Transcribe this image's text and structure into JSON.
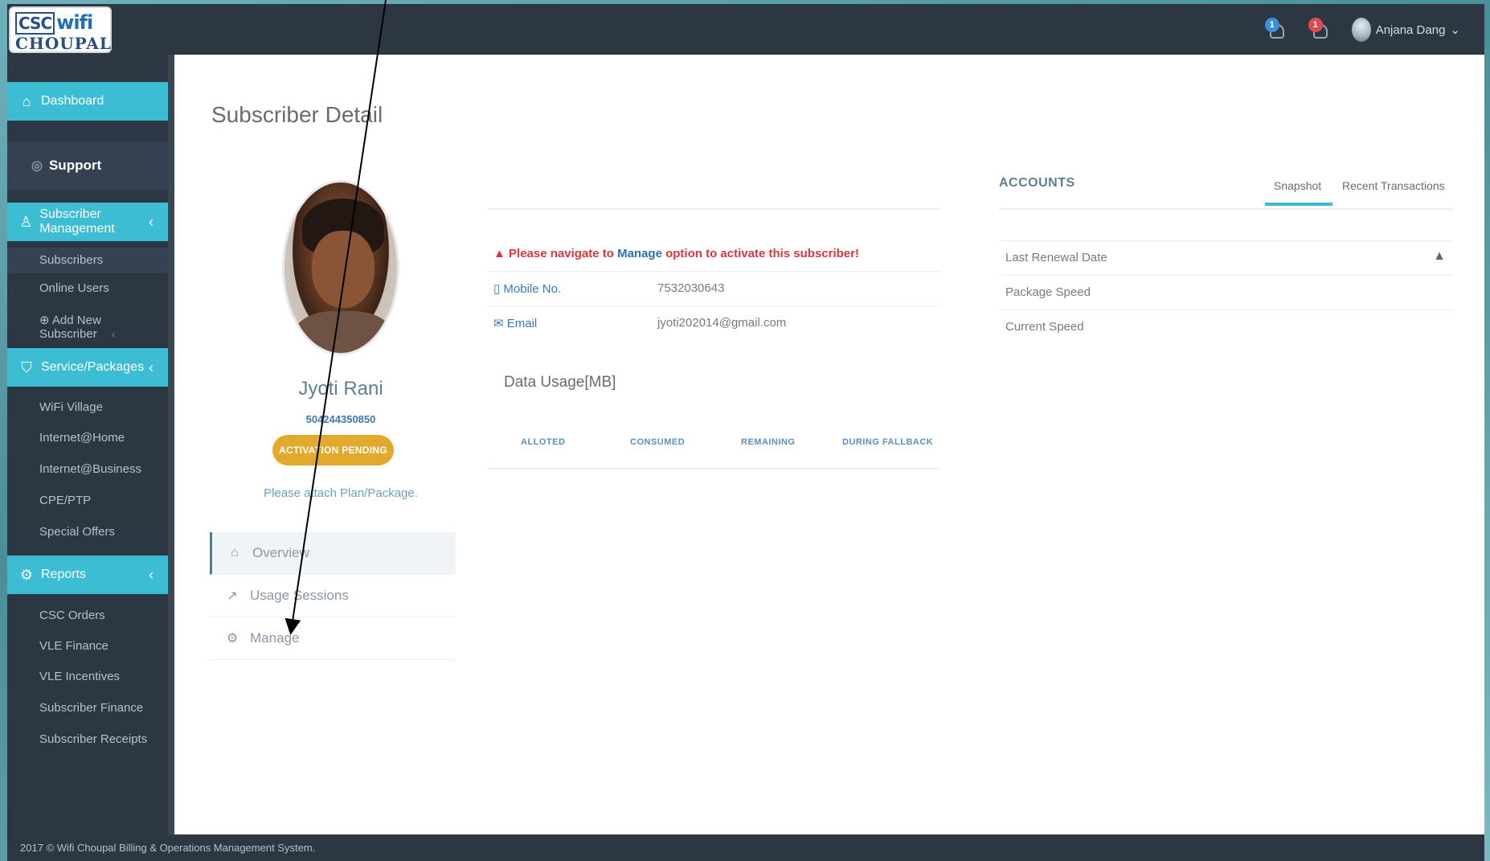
{
  "header": {
    "logo_line1_prefix": "CSC",
    "logo_line1": "wifi",
    "logo_line2": "CHOUPAL",
    "notifications_count": "1",
    "cart_count": "1",
    "user_name": "Anjana Dang",
    "user_chevron": "⌄"
  },
  "sidebar": {
    "dashboard": "Dashboard",
    "support": "Support",
    "subscriber_management": "Subscriber Management",
    "subscriber_items": [
      "Subscribers",
      "Online Users",
      "Add New Subscriber"
    ],
    "service_packages": "Service/Packages",
    "service_items": [
      "WiFi Village",
      "Internet@Home",
      "Internet@Business",
      "CPE/PTP",
      "Special Offers"
    ],
    "reports": "Reports",
    "report_items": [
      "CSC Orders",
      "VLE Finance",
      "VLE Incentives",
      "Subscriber Finance",
      "Subscriber Receipts"
    ]
  },
  "main": {
    "page_title": "Subscriber Detail",
    "subscriber": {
      "name": "Jyoti Rani",
      "id": "504244350850",
      "status": "ACTIVATION PENDING",
      "note": "Please attach Plan/Package."
    },
    "nav": [
      "Overview",
      "Usage Sessions",
      "Manage"
    ],
    "alert": {
      "prefix": "Please navigate to ",
      "link": "Manage",
      "suffix": " option to activate this subscriber!"
    },
    "details": [
      {
        "label": "Mobile No.",
        "value": "7532030643"
      },
      {
        "label": "Email",
        "value": "jyoti202014@gmail.com"
      }
    ],
    "usage": {
      "title": "Data Usage[MB]",
      "columns": [
        "ALLOTED",
        "CONSUMED",
        "REMAINING",
        "DURING FALLBACK"
      ]
    },
    "accounts": {
      "title": "ACCOUNTS",
      "tabs": [
        "Snapshot",
        "Recent Transactions"
      ],
      "active_tab": "Snapshot",
      "rows": [
        "Last Renewal Date",
        "Package Speed",
        "Current Speed"
      ]
    }
  },
  "footer": {
    "text": "2017 © Wifi Choupal Billing & Operations Management System."
  },
  "colors": {
    "accent": "#3cbdd3",
    "navy": "#2d3743",
    "warning": "#e3a92c",
    "alert": "#d9363e",
    "link": "#2d6fb0"
  }
}
